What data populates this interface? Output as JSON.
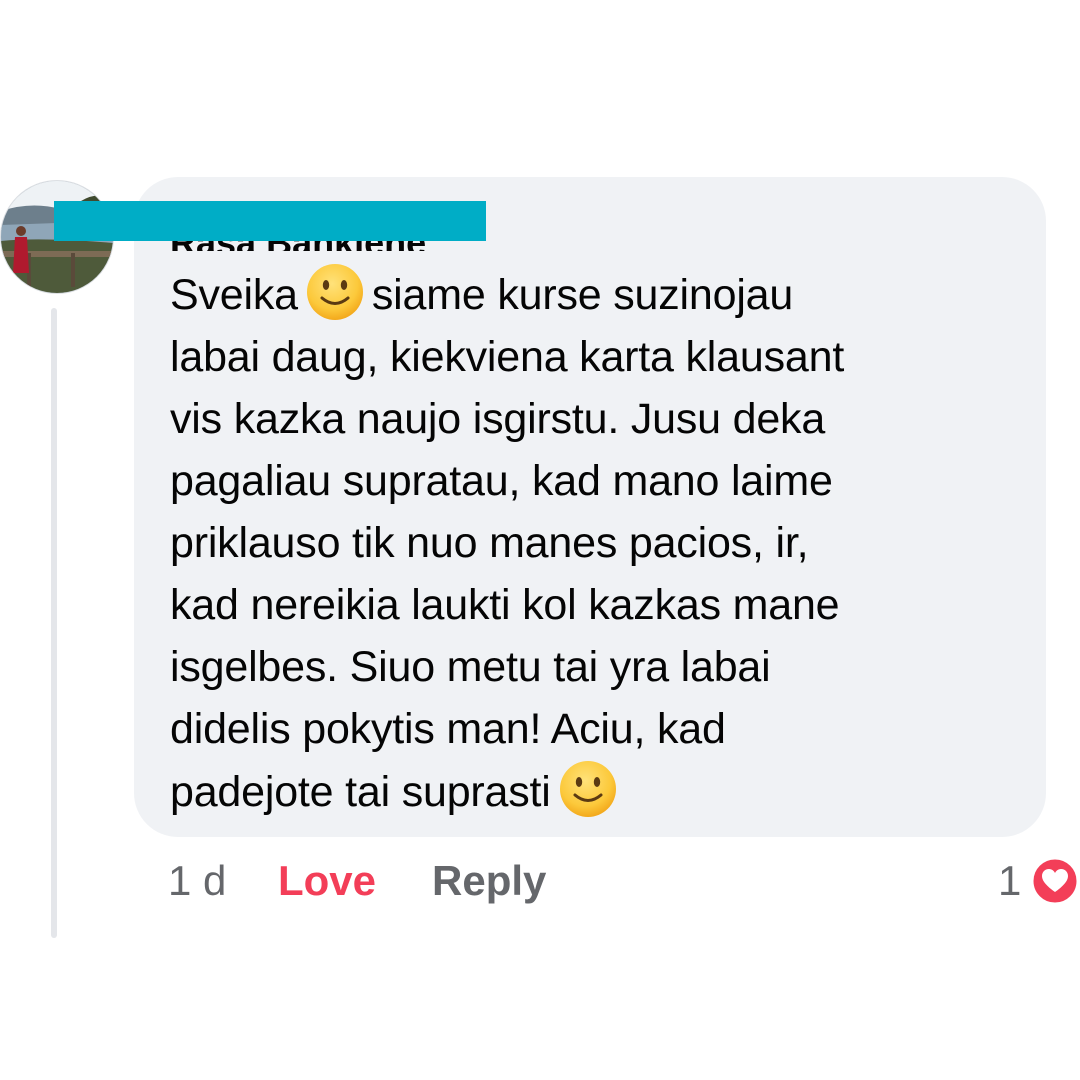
{
  "comment": {
    "author": "Rasa Bankiene",
    "text_lines": [
      {
        "before": "Sveika",
        "emoji": "slightly-smiling-face",
        "after": "siame kurse suzinojau"
      },
      {
        "text": "labai daug, kiekviena karta klausant"
      },
      {
        "text": "vis kazka naujo isgirstu. Jusu deka"
      },
      {
        "text": "pagaliau supratau, kad mano laime"
      },
      {
        "text": "priklauso tik nuo manes pacios, ir,"
      },
      {
        "text": "kad nereikia laukti kol kazkas mane"
      },
      {
        "text": "isgelbes. Siuo metu tai yra labai"
      },
      {
        "text": "didelis pokytis man! Aciu, kad"
      },
      {
        "before": "padejote tai suprasti",
        "emoji": "slightly-smiling-face"
      }
    ],
    "time": "1 d",
    "love_label": "Love",
    "reply_label": "Reply",
    "reaction_count": "1",
    "reaction_icon": "heart-icon"
  },
  "colors": {
    "bubble": "#f0f2f5",
    "love": "#f33e58",
    "meta": "#65676b",
    "redaction": "#00adc6"
  }
}
